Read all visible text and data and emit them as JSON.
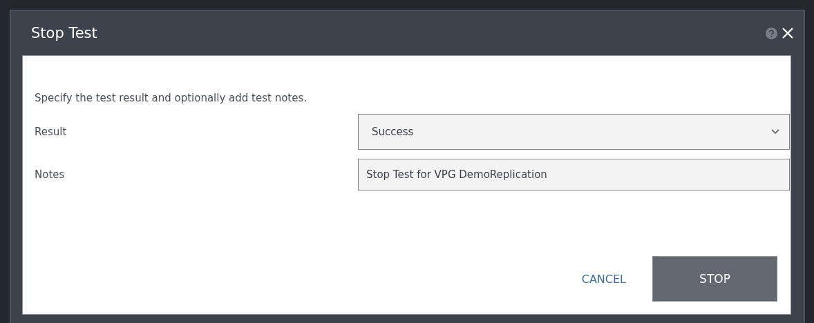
{
  "dialog": {
    "title": "Stop Test",
    "description": "Specify the test result and optionally add test notes.",
    "fields": [
      {
        "kind": "select",
        "label": "Result",
        "value": "Success"
      },
      {
        "kind": "text",
        "label": "Notes",
        "value": "Stop Test for VPG DemoReplication"
      }
    ],
    "buttons": [
      {
        "kind": "link",
        "label": "CANCEL"
      },
      {
        "kind": "primary",
        "label": "STOP"
      }
    ]
  }
}
